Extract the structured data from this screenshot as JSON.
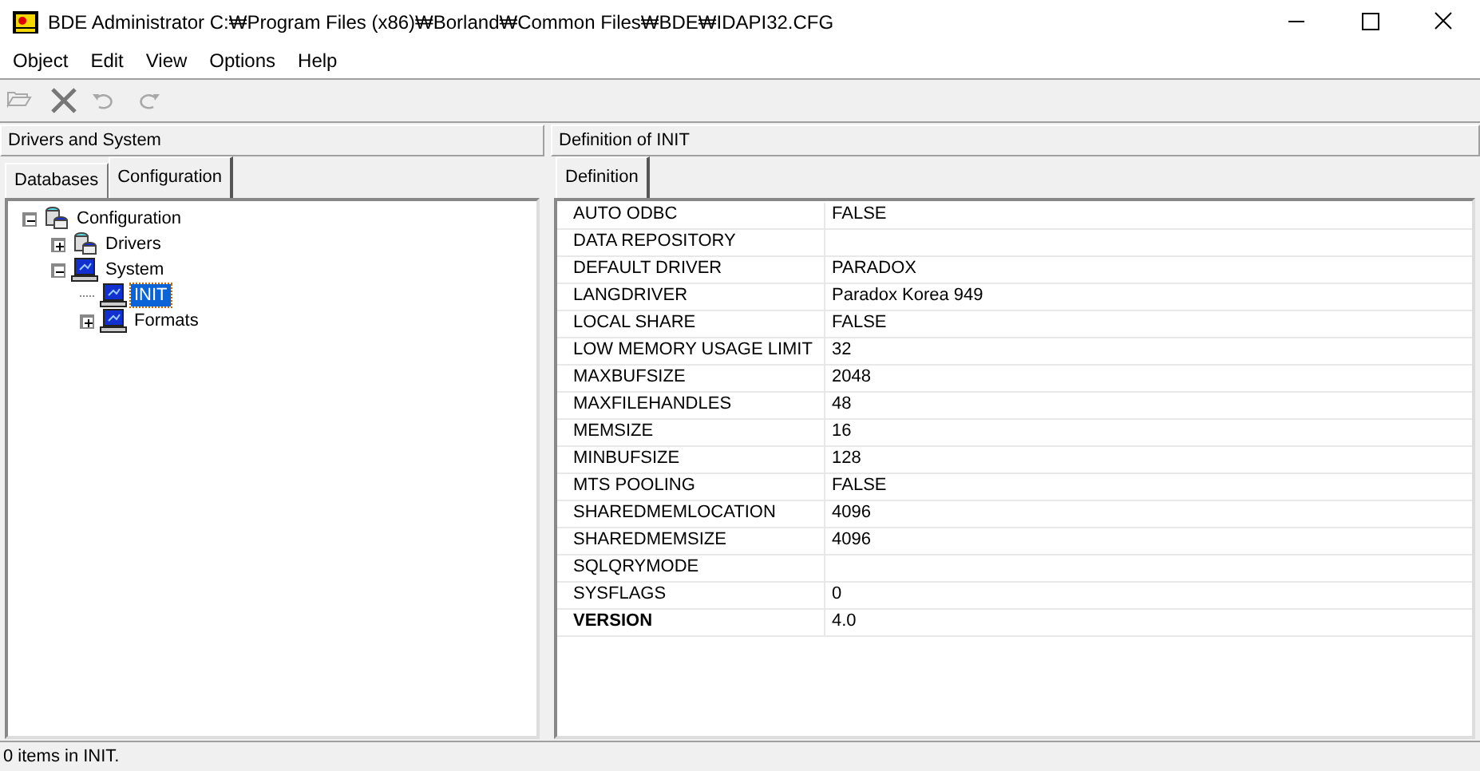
{
  "window": {
    "title": "BDE Administrator  C:₩Program Files (x86)₩Borland₩Common Files₩BDE₩IDAPI32.CFG"
  },
  "menu": [
    "Object",
    "Edit",
    "View",
    "Options",
    "Help"
  ],
  "toolbar": [
    {
      "kind": "open",
      "disabled": true
    },
    {
      "kind": "delete",
      "disabled": false
    },
    {
      "kind": "undo",
      "disabled": true
    },
    {
      "kind": "redo",
      "disabled": true
    }
  ],
  "left_panel": {
    "header": "Drivers and System",
    "tabs": [
      {
        "label": "Databases",
        "selected": false
      },
      {
        "label": "Configuration",
        "selected": true
      }
    ],
    "tree": [
      {
        "label": "Configuration",
        "kind": "database",
        "expanded": true,
        "selected": false,
        "children": [
          {
            "label": "Drivers",
            "kind": "database",
            "expanded": false,
            "selected": false
          },
          {
            "label": "System",
            "kind": "computer",
            "expanded": true,
            "selected": false,
            "children": [
              {
                "label": "INIT",
                "kind": "computer",
                "selected": true
              },
              {
                "label": "Formats",
                "kind": "computer",
                "expanded": false,
                "selected": false
              }
            ]
          }
        ]
      }
    ]
  },
  "right_panel": {
    "header": "Definition of INIT",
    "tabs": [
      {
        "label": "Definition",
        "selected": true
      }
    ],
    "rows": [
      {
        "name": "AUTO ODBC",
        "value": "FALSE",
        "bold": false
      },
      {
        "name": "DATA REPOSITORY",
        "bold": false
      },
      {
        "name": "DEFAULT DRIVER",
        "value": "PARADOX",
        "bold": false
      },
      {
        "name": "LANGDRIVER",
        "value": "Paradox Korea 949",
        "bold": false
      },
      {
        "name": "LOCAL SHARE",
        "value": "FALSE",
        "bold": false
      },
      {
        "name": "LOW MEMORY USAGE LIMIT",
        "value": "32",
        "bold": false
      },
      {
        "name": "MAXBUFSIZE",
        "value": "2048",
        "bold": false
      },
      {
        "name": "MAXFILEHANDLES",
        "value": "48",
        "bold": false
      },
      {
        "name": "MEMSIZE",
        "value": "16",
        "bold": false
      },
      {
        "name": "MINBUFSIZE",
        "value": "128",
        "bold": false
      },
      {
        "name": "MTS POOLING",
        "value": "FALSE",
        "bold": false
      },
      {
        "name": "SHAREDMEMLOCATION",
        "value": "4096",
        "bold": false
      },
      {
        "name": "SHAREDMEMSIZE",
        "value": "4096",
        "bold": false
      },
      {
        "name": "SQLQRYMODE",
        "bold": false
      },
      {
        "name": "SYSFLAGS",
        "value": "0",
        "bold": false
      },
      {
        "name": "VERSION",
        "value": "4.0",
        "bold": true
      }
    ]
  },
  "status_bar": "0 items in INIT."
}
